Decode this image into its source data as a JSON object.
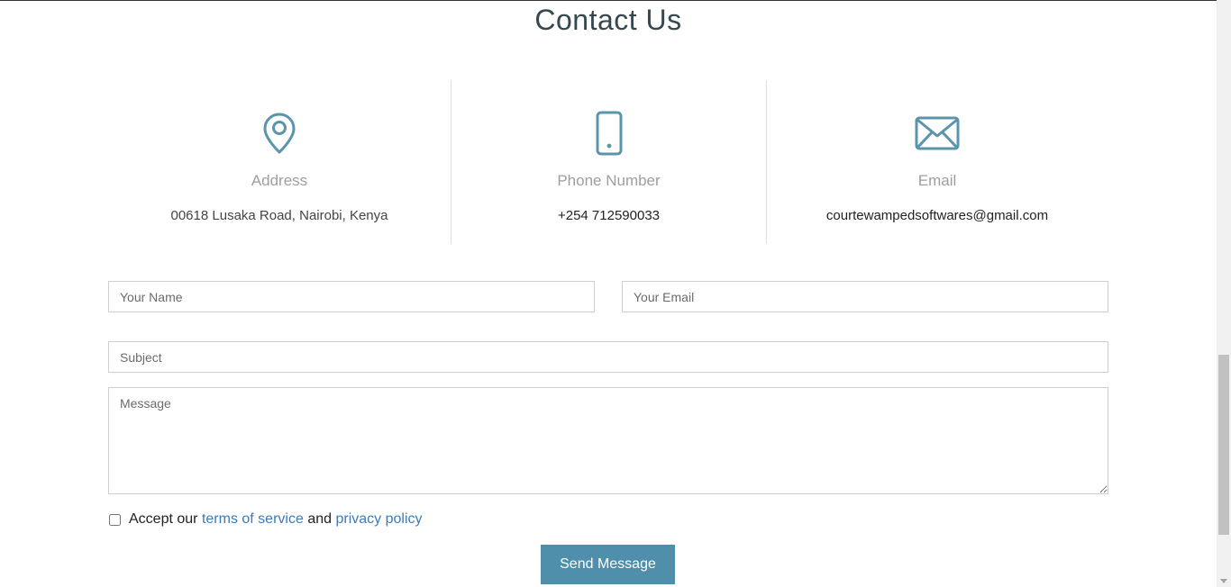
{
  "page": {
    "title": "Contact Us"
  },
  "contact_info": {
    "address": {
      "icon": "location-pin-icon",
      "label": "Address",
      "value": "00618 Lusaka Road, Nairobi, Kenya"
    },
    "phone": {
      "icon": "smartphone-icon",
      "label": "Phone Number",
      "value": "+254 712590033"
    },
    "email": {
      "icon": "envelope-icon",
      "label": "Email",
      "value": "courtewampedsoftwares@gmail.com"
    }
  },
  "form": {
    "name_placeholder": "Your Name",
    "email_placeholder": "Your Email",
    "subject_placeholder": "Subject",
    "message_placeholder": "Message",
    "accept_prefix": "Accept our",
    "terms_link": "terms of service",
    "accept_middle": "and",
    "privacy_link": "privacy policy",
    "submit_label": "Send Message"
  },
  "colors": {
    "accent": "#4f8fac",
    "link": "#3a7cb8"
  }
}
